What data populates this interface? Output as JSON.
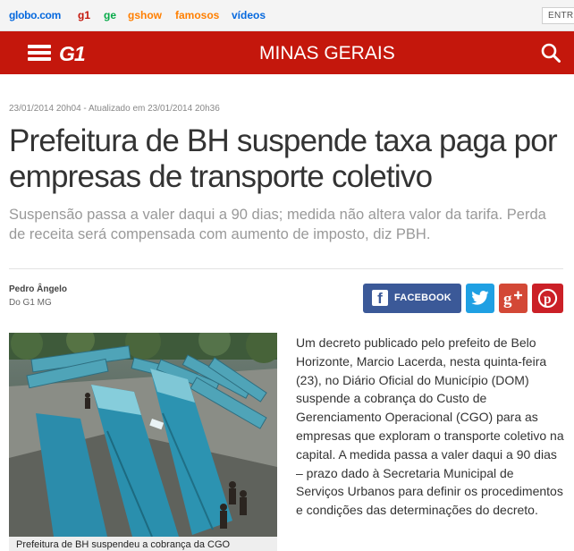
{
  "globo_bar": {
    "links": [
      "globo.com",
      "g1",
      "ge",
      "gshow",
      "famosos",
      "vídeos"
    ],
    "entrar": "ENTRE"
  },
  "header": {
    "logo": "G1",
    "section": "MINAS GERAIS",
    "brand_color": "#c4170c"
  },
  "article": {
    "dateline": "23/01/2014 20h04 - Atualizado em 23/01/2014 20h36",
    "headline": "Prefeitura de BH suspende taxa paga por empresas de transporte coletivo",
    "subtitle": "Suspensão passa a valer daqui a 90 dias; medida não altera valor da tarifa. Perda de receita será compensada com aumento de imposto, diz PBH.",
    "author": "Pedro Ângelo",
    "author_org": "Do G1 MG",
    "body": "Um decreto publicado pelo prefeito de Belo Horizonte, Marcio Lacerda, nesta quinta-feira (23), no Diário Oficial do Município (DOM) suspende a cobrança do Custo de Gerenciamento Operacional (CGO) para as empresas que exploram o transporte coletivo na capital. A medida passa a valer daqui a 90 dias – prazo dado à Secretaria Municipal de Serviços Urbanos para definir os procedimentos e condições das determinações do decreto.",
    "photo_caption": "Prefeitura de BH suspendeu a cobrança da CGO"
  },
  "share": {
    "facebook_label": "FACEBOOK",
    "facebook_color": "#3b5998",
    "twitter_color": "#1fa0e3",
    "googleplus_color": "#d34836",
    "pinterest_color": "#cb2027",
    "icons": [
      "facebook-icon",
      "twitter-icon",
      "google-plus-icon",
      "pinterest-icon"
    ]
  }
}
